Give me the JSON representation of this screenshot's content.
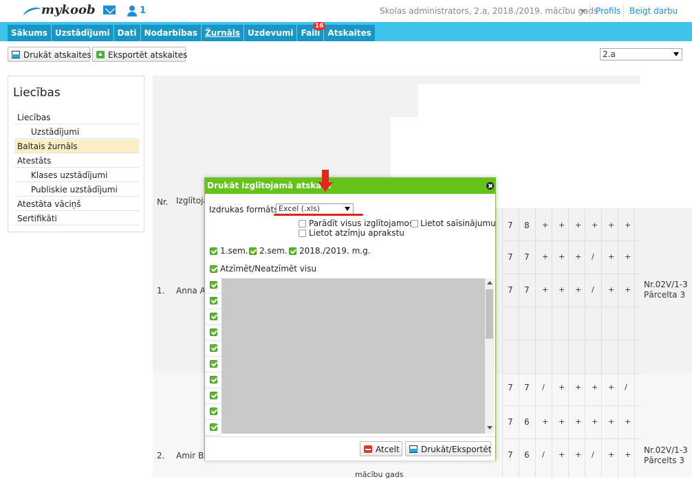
{
  "header": {
    "logo_text": "mykoob",
    "user_count": "1",
    "role_text": "Skolas administrators, 2.a, 2018./2019. mācību gads",
    "profile_label": "Profils",
    "logout_label": "Beigt darbu"
  },
  "nav": {
    "items": [
      {
        "label": "Sākums"
      },
      {
        "label": "Uzstādījumi"
      },
      {
        "label": "Dati"
      },
      {
        "label": "Nodarbības"
      },
      {
        "label": "Žurnāls"
      },
      {
        "label": "Uzdevumi"
      },
      {
        "label": "Faili",
        "badge": "16"
      },
      {
        "label": "Atskaites"
      }
    ],
    "active_index": 4
  },
  "toolbar": {
    "print_label": "Drukāt atskaites",
    "export_label": "Eksportēt atskaites",
    "class_value": "2.a"
  },
  "sidebar": {
    "title": "Liecības",
    "items": [
      {
        "label": "Liecības"
      },
      {
        "label": "Uzstādījumi"
      },
      {
        "label": "Baltais žurnāls"
      },
      {
        "label": "Atestāts"
      },
      {
        "label": "Klases uzstādījumi"
      },
      {
        "label": "Publiskie uzstādījumi"
      },
      {
        "label": "Atestāta vāciņš"
      },
      {
        "label": "Sertifikāti"
      }
    ]
  },
  "table": {
    "col_nr": "Nr.",
    "col_name": "Izglītoja",
    "rows": [
      {
        "nr": "1.",
        "name": "Anna Al",
        "note1": "Nr.02V/1-3",
        "note2": "Pārcelta 3"
      },
      {
        "nr": "2.",
        "name": "Amir Be",
        "note1": "Nr.02V/1-3",
        "note2": "Pārcelts 3"
      }
    ],
    "footer_text": "mācību gads",
    "grades": [
      [
        "7",
        "8",
        "+",
        "+",
        "+",
        "+",
        "+",
        "+"
      ],
      [
        "7",
        "7",
        "+",
        "+",
        "+",
        "/",
        "+",
        "+"
      ],
      [
        "7",
        "7",
        "+",
        "+",
        "+",
        "/",
        "+",
        "+"
      ],
      [
        "7",
        "7",
        "/",
        "+",
        "+",
        "+",
        "+",
        "/"
      ],
      [
        "7",
        "6",
        "+",
        "+",
        "+",
        "+",
        "+",
        "+"
      ],
      [
        "7",
        "6",
        "/",
        "+",
        "+",
        "/",
        "+",
        "+"
      ]
    ]
  },
  "modal": {
    "title": "Drukāt izglītojamā atskaiti",
    "format_label": "Izdrukas formāts:",
    "format_value": "Excel (.xls)",
    "options": [
      {
        "label": "Parādīt visus izglītojamos",
        "checked": false
      },
      {
        "label": "Lietot saīsinājumu",
        "checked": false
      },
      {
        "label": "Lietot atzīmju aprakstu",
        "checked": false
      }
    ],
    "periods": [
      {
        "label": "1.sem.",
        "checked": true
      },
      {
        "label": "2.sem.",
        "checked": true
      },
      {
        "label": "2018./2019. m.g.",
        "checked": true
      }
    ],
    "select_all_label": "Atzīmēt/Neatzīmēt visu",
    "cancel_label": "Atcelt",
    "submit_label": "Drukāt/Eksportēt"
  },
  "colors": {
    "accent": "#40c3ea",
    "nav_dark": "#1897c7",
    "modal_header": "#64c31a",
    "annotation": "#e0261d",
    "highlight": "#fbedc4"
  }
}
